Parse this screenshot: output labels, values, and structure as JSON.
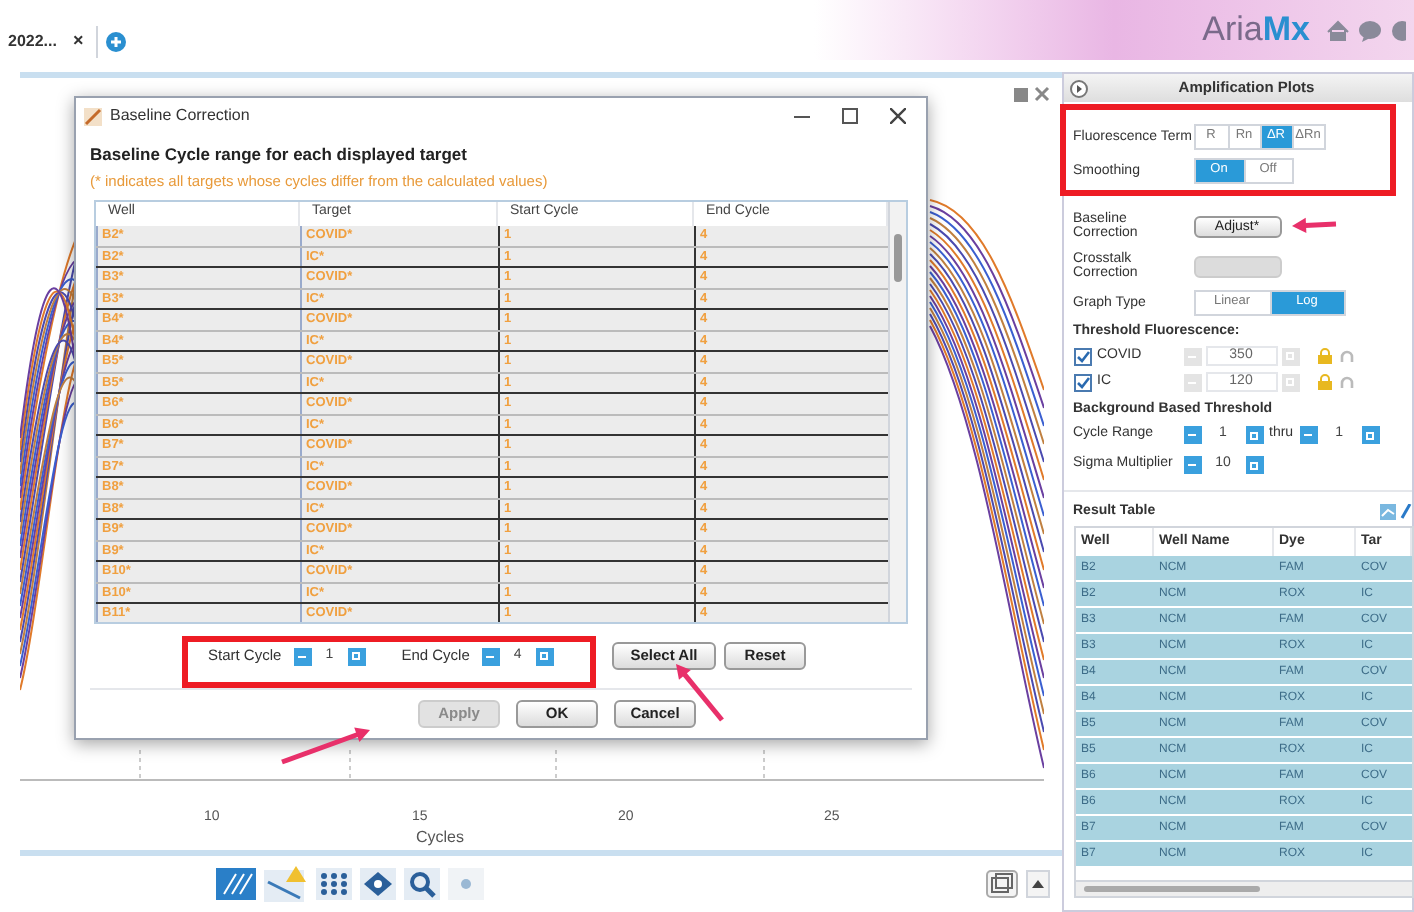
{
  "tab": {
    "label": "2022...",
    "close": "×"
  },
  "logo": {
    "part1": "Aria",
    "part2": "Mx"
  },
  "plot": {
    "xticks": [
      "10",
      "15",
      "20",
      "25"
    ],
    "xlabel": "Cycles"
  },
  "dialog": {
    "title": "Baseline Correction",
    "heading": "Baseline Cycle range for each displayed target",
    "note": "(* indicates all targets whose cycles differ from the calculated values)",
    "columns": [
      "Well",
      "Target",
      "Start Cycle",
      "End Cycle"
    ],
    "rows": [
      [
        "B2*",
        "COVID*",
        "1",
        "4"
      ],
      [
        "B2*",
        "IC*",
        "1",
        "4"
      ],
      [
        "B3*",
        "COVID*",
        "1",
        "4"
      ],
      [
        "B3*",
        "IC*",
        "1",
        "4"
      ],
      [
        "B4*",
        "COVID*",
        "1",
        "4"
      ],
      [
        "B4*",
        "IC*",
        "1",
        "4"
      ],
      [
        "B5*",
        "COVID*",
        "1",
        "4"
      ],
      [
        "B5*",
        "IC*",
        "1",
        "4"
      ],
      [
        "B6*",
        "COVID*",
        "1",
        "4"
      ],
      [
        "B6*",
        "IC*",
        "1",
        "4"
      ],
      [
        "B7*",
        "COVID*",
        "1",
        "4"
      ],
      [
        "B7*",
        "IC*",
        "1",
        "4"
      ],
      [
        "B8*",
        "COVID*",
        "1",
        "4"
      ],
      [
        "B8*",
        "IC*",
        "1",
        "4"
      ],
      [
        "B9*",
        "COVID*",
        "1",
        "4"
      ],
      [
        "B9*",
        "IC*",
        "1",
        "4"
      ],
      [
        "B10*",
        "COVID*",
        "1",
        "4"
      ],
      [
        "B10*",
        "IC*",
        "1",
        "4"
      ],
      [
        "B11*",
        "COVID*",
        "1",
        "4"
      ]
    ],
    "start_cycle": {
      "label": "Start Cycle",
      "value": "1"
    },
    "end_cycle": {
      "label": "End Cycle",
      "value": "4"
    },
    "buttons": [
      {
        "label": "Select All",
        "disabled": false
      },
      {
        "label": "Reset",
        "disabled": false
      }
    ],
    "footer_buttons": [
      {
        "label": "Apply",
        "disabled": true
      },
      {
        "label": "OK",
        "disabled": false
      },
      {
        "label": "Cancel",
        "disabled": false
      }
    ]
  },
  "panel": {
    "title": "Amplification Plots",
    "fluorescence_term": {
      "label": "Fluorescence Term",
      "options": [
        {
          "label": "R",
          "selected": false
        },
        {
          "label": "Rn",
          "selected": false
        },
        {
          "label": "ΔR",
          "selected": true
        },
        {
          "label": "ΔRn",
          "selected": false
        }
      ]
    },
    "smoothing": {
      "label": "Smoothing",
      "options": [
        {
          "label": "On",
          "selected": true
        },
        {
          "label": "Off",
          "selected": false
        }
      ]
    },
    "baseline_correction": {
      "label": "Baseline Correction",
      "button": "Adjust*",
      "disabled": false
    },
    "crosstalk_correction": {
      "label": "Crosstalk Correction",
      "disabled": true
    },
    "graph_type": {
      "label": "Graph Type",
      "options": [
        {
          "label": "Linear",
          "selected": false
        },
        {
          "label": "Log",
          "selected": true
        }
      ]
    },
    "threshold_heading": "Threshold Fluorescence:",
    "thresholds": [
      {
        "label": "COVID",
        "checked": true,
        "value": "350"
      },
      {
        "label": "IC",
        "checked": true,
        "value": "120"
      }
    ],
    "background_heading": "Background Based Threshold",
    "cycle_range": {
      "label": "Cycle Range",
      "from": "1",
      "thru": "thru",
      "to": "1"
    },
    "sigma_multiplier": {
      "label": "Sigma Multiplier",
      "value": "10"
    },
    "result_table": {
      "title": "Result Table",
      "columns": [
        "Well",
        "Well Name",
        "Dye",
        "Tar"
      ],
      "rows": [
        [
          "B2",
          "NCM",
          "FAM",
          "COV"
        ],
        [
          "B2",
          "NCM",
          "ROX",
          "IC"
        ],
        [
          "B3",
          "NCM",
          "FAM",
          "COV"
        ],
        [
          "B3",
          "NCM",
          "ROX",
          "IC"
        ],
        [
          "B4",
          "NCM",
          "FAM",
          "COV"
        ],
        [
          "B4",
          "NCM",
          "ROX",
          "IC"
        ],
        [
          "B5",
          "NCM",
          "FAM",
          "COV"
        ],
        [
          "B5",
          "NCM",
          "ROX",
          "IC"
        ],
        [
          "B6",
          "NCM",
          "FAM",
          "COV"
        ],
        [
          "B6",
          "NCM",
          "ROX",
          "IC"
        ],
        [
          "B7",
          "NCM",
          "FAM",
          "COV"
        ],
        [
          "B7",
          "NCM",
          "ROX",
          "IC"
        ]
      ]
    }
  }
}
